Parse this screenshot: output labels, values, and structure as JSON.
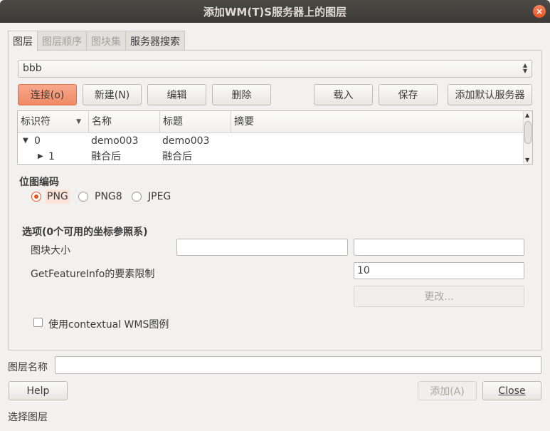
{
  "window": {
    "title": "添加WM(T)S服务器上的图层",
    "close_glyph": "×"
  },
  "tabs": [
    {
      "label": "图层",
      "state": "active"
    },
    {
      "label": "图层顺序",
      "state": "disabled"
    },
    {
      "label": "图块集",
      "state": "disabled"
    },
    {
      "label": "服务器搜索",
      "state": "enabled"
    }
  ],
  "server_select": {
    "value": "bbb"
  },
  "buttons": {
    "connect": "连接(o)",
    "new": "新建(N)",
    "edit": "编辑",
    "delete": "删除",
    "load": "载入",
    "save": "保存",
    "add_default": "添加默认服务器",
    "change": "更改...",
    "help": "Help",
    "add": "添加(A)",
    "close": "Close"
  },
  "layer_table": {
    "columns": [
      "标识符",
      "名称",
      "标题",
      "摘要"
    ],
    "rows": [
      {
        "id": "0",
        "name": "demo003",
        "title": "demo003",
        "abstract": "",
        "expanded": true,
        "depth": 0
      },
      {
        "id": "1",
        "name": "融合后",
        "title": "融合后",
        "abstract": "",
        "expanded": false,
        "depth": 1
      }
    ]
  },
  "encoding": {
    "heading": "位图编码",
    "options": [
      "PNG",
      "PNG8",
      "JPEG"
    ],
    "selected": "PNG"
  },
  "options": {
    "heading": "选项(0个可用的坐标参照系)",
    "tile_size_label": "图块大小",
    "tile_width": "",
    "tile_height": "",
    "feature_limit_label": "GetFeatureInfo的要素限制",
    "feature_limit": "10",
    "contextual_legend_label": "使用contextual WMS图例",
    "contextual_legend_checked": false
  },
  "layer_name": {
    "label": "图层名称",
    "value": ""
  },
  "status": "选择图层",
  "colors": {
    "accent": "#e95420",
    "titlebar": "#3c3b37"
  }
}
